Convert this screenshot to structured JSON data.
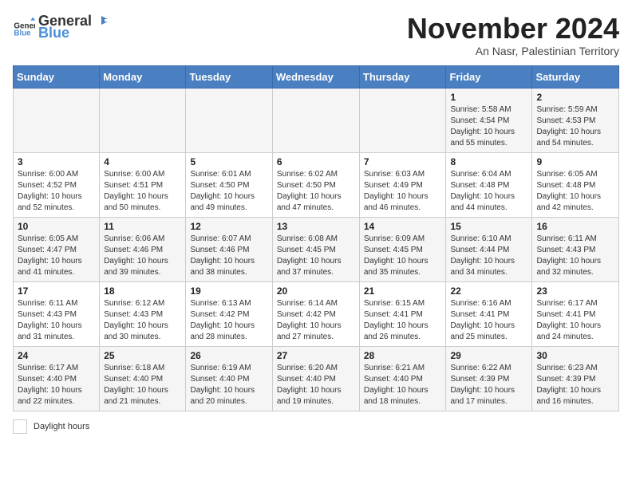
{
  "logo": {
    "general": "General",
    "blue": "Blue"
  },
  "title": "November 2024",
  "subtitle": "An Nasr, Palestinian Territory",
  "days_of_week": [
    "Sunday",
    "Monday",
    "Tuesday",
    "Wednesday",
    "Thursday",
    "Friday",
    "Saturday"
  ],
  "weeks": [
    [
      {
        "day": "",
        "info": ""
      },
      {
        "day": "",
        "info": ""
      },
      {
        "day": "",
        "info": ""
      },
      {
        "day": "",
        "info": ""
      },
      {
        "day": "",
        "info": ""
      },
      {
        "day": "1",
        "info": "Sunrise: 5:58 AM\nSunset: 4:54 PM\nDaylight: 10 hours and 55 minutes."
      },
      {
        "day": "2",
        "info": "Sunrise: 5:59 AM\nSunset: 4:53 PM\nDaylight: 10 hours and 54 minutes."
      }
    ],
    [
      {
        "day": "3",
        "info": "Sunrise: 6:00 AM\nSunset: 4:52 PM\nDaylight: 10 hours and 52 minutes."
      },
      {
        "day": "4",
        "info": "Sunrise: 6:00 AM\nSunset: 4:51 PM\nDaylight: 10 hours and 50 minutes."
      },
      {
        "day": "5",
        "info": "Sunrise: 6:01 AM\nSunset: 4:50 PM\nDaylight: 10 hours and 49 minutes."
      },
      {
        "day": "6",
        "info": "Sunrise: 6:02 AM\nSunset: 4:50 PM\nDaylight: 10 hours and 47 minutes."
      },
      {
        "day": "7",
        "info": "Sunrise: 6:03 AM\nSunset: 4:49 PM\nDaylight: 10 hours and 46 minutes."
      },
      {
        "day": "8",
        "info": "Sunrise: 6:04 AM\nSunset: 4:48 PM\nDaylight: 10 hours and 44 minutes."
      },
      {
        "day": "9",
        "info": "Sunrise: 6:05 AM\nSunset: 4:48 PM\nDaylight: 10 hours and 42 minutes."
      }
    ],
    [
      {
        "day": "10",
        "info": "Sunrise: 6:05 AM\nSunset: 4:47 PM\nDaylight: 10 hours and 41 minutes."
      },
      {
        "day": "11",
        "info": "Sunrise: 6:06 AM\nSunset: 4:46 PM\nDaylight: 10 hours and 39 minutes."
      },
      {
        "day": "12",
        "info": "Sunrise: 6:07 AM\nSunset: 4:46 PM\nDaylight: 10 hours and 38 minutes."
      },
      {
        "day": "13",
        "info": "Sunrise: 6:08 AM\nSunset: 4:45 PM\nDaylight: 10 hours and 37 minutes."
      },
      {
        "day": "14",
        "info": "Sunrise: 6:09 AM\nSunset: 4:45 PM\nDaylight: 10 hours and 35 minutes."
      },
      {
        "day": "15",
        "info": "Sunrise: 6:10 AM\nSunset: 4:44 PM\nDaylight: 10 hours and 34 minutes."
      },
      {
        "day": "16",
        "info": "Sunrise: 6:11 AM\nSunset: 4:43 PM\nDaylight: 10 hours and 32 minutes."
      }
    ],
    [
      {
        "day": "17",
        "info": "Sunrise: 6:11 AM\nSunset: 4:43 PM\nDaylight: 10 hours and 31 minutes."
      },
      {
        "day": "18",
        "info": "Sunrise: 6:12 AM\nSunset: 4:43 PM\nDaylight: 10 hours and 30 minutes."
      },
      {
        "day": "19",
        "info": "Sunrise: 6:13 AM\nSunset: 4:42 PM\nDaylight: 10 hours and 28 minutes."
      },
      {
        "day": "20",
        "info": "Sunrise: 6:14 AM\nSunset: 4:42 PM\nDaylight: 10 hours and 27 minutes."
      },
      {
        "day": "21",
        "info": "Sunrise: 6:15 AM\nSunset: 4:41 PM\nDaylight: 10 hours and 26 minutes."
      },
      {
        "day": "22",
        "info": "Sunrise: 6:16 AM\nSunset: 4:41 PM\nDaylight: 10 hours and 25 minutes."
      },
      {
        "day": "23",
        "info": "Sunrise: 6:17 AM\nSunset: 4:41 PM\nDaylight: 10 hours and 24 minutes."
      }
    ],
    [
      {
        "day": "24",
        "info": "Sunrise: 6:17 AM\nSunset: 4:40 PM\nDaylight: 10 hours and 22 minutes."
      },
      {
        "day": "25",
        "info": "Sunrise: 6:18 AM\nSunset: 4:40 PM\nDaylight: 10 hours and 21 minutes."
      },
      {
        "day": "26",
        "info": "Sunrise: 6:19 AM\nSunset: 4:40 PM\nDaylight: 10 hours and 20 minutes."
      },
      {
        "day": "27",
        "info": "Sunrise: 6:20 AM\nSunset: 4:40 PM\nDaylight: 10 hours and 19 minutes."
      },
      {
        "day": "28",
        "info": "Sunrise: 6:21 AM\nSunset: 4:40 PM\nDaylight: 10 hours and 18 minutes."
      },
      {
        "day": "29",
        "info": "Sunrise: 6:22 AM\nSunset: 4:39 PM\nDaylight: 10 hours and 17 minutes."
      },
      {
        "day": "30",
        "info": "Sunrise: 6:23 AM\nSunset: 4:39 PM\nDaylight: 10 hours and 16 minutes."
      }
    ]
  ],
  "legend": {
    "box_label": "Daylight hours"
  }
}
